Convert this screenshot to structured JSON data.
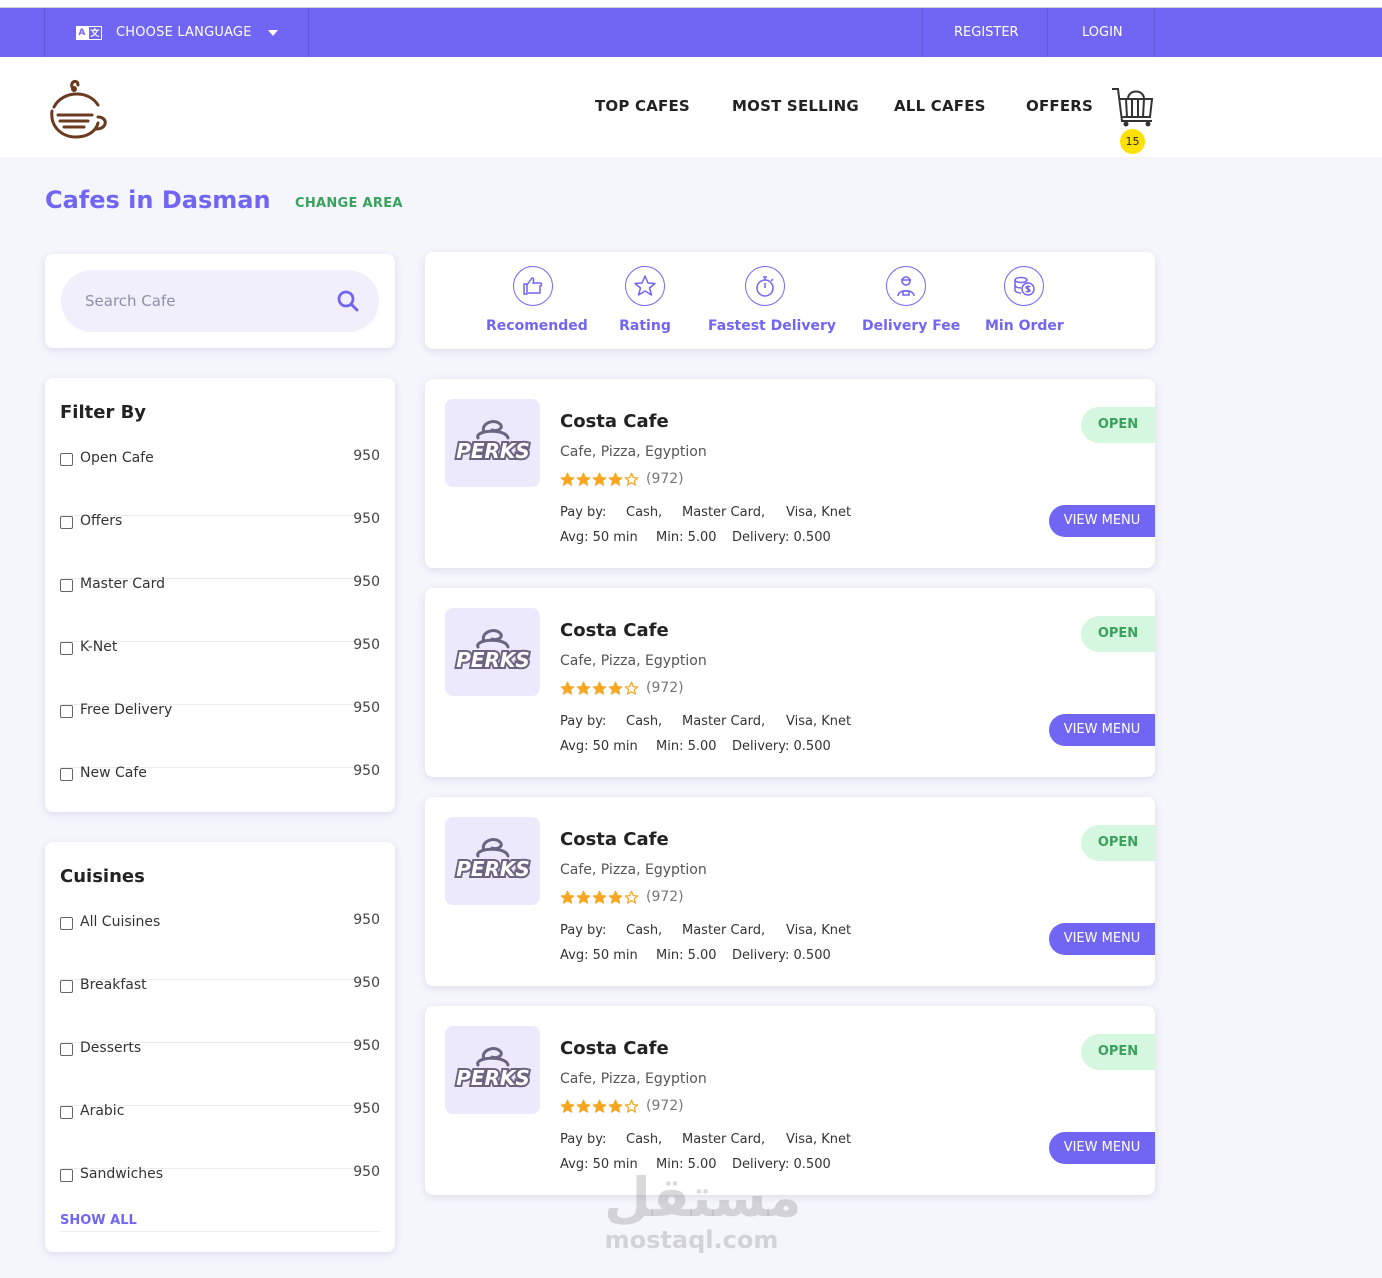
{
  "topbar": {
    "language_label": "CHOOSE LANGUAGE",
    "language_icon": "translate-icon",
    "register_label": "REGISTER",
    "login_label": "LOGIN"
  },
  "nav": {
    "items": [
      "TOP CAFES",
      "MOST SELLING",
      "ALL CAFES",
      "OFFERS"
    ],
    "cart_count": "15"
  },
  "page": {
    "title": "Cafes in Dasman",
    "change_area": "CHANGE AREA"
  },
  "search": {
    "placeholder": "Search Cafe"
  },
  "sort": {
    "items": [
      "Recomended",
      "Rating",
      "Fastest Delivery",
      "Delivery Fee",
      "Min Order"
    ]
  },
  "filter": {
    "title": "Filter By",
    "items": [
      {
        "label": "Open Cafe",
        "count": "950"
      },
      {
        "label": "Offers",
        "count": "950"
      },
      {
        "label": "Master Card",
        "count": "950"
      },
      {
        "label": "K-Net",
        "count": "950"
      },
      {
        "label": "Free Delivery",
        "count": "950"
      },
      {
        "label": "New Cafe",
        "count": "950"
      }
    ]
  },
  "cuisines": {
    "title": "Cuisines",
    "items": [
      {
        "label": "All Cuisines",
        "count": "950"
      },
      {
        "label": "Breakfast",
        "count": "950"
      },
      {
        "label": "Desserts",
        "count": "950"
      },
      {
        "label": "Arabic",
        "count": "950"
      },
      {
        "label": "Sandwiches",
        "count": "950"
      }
    ],
    "show_all": "SHOW ALL"
  },
  "cafes": [
    {
      "name": "Costa Cafe",
      "cuisine": "Cafe, Pizza, Egyption",
      "rating": 4,
      "reviews": "(972)",
      "pay_label": "Pay by:",
      "pay_1": "Cash,",
      "pay_2": "Master Card,",
      "pay_3": "Visa, Knet",
      "avg": "Avg: 50 min",
      "min": "Min: 5.00",
      "delivery": "Delivery: 0.500",
      "status": "OPEN",
      "button": "VIEW MENU",
      "logo_text": "PERKS"
    },
    {
      "name": "Costa Cafe",
      "cuisine": "Cafe, Pizza, Egyption",
      "rating": 4,
      "reviews": "(972)",
      "pay_label": "Pay by:",
      "pay_1": "Cash,",
      "pay_2": "Master Card,",
      "pay_3": "Visa, Knet",
      "avg": "Avg: 50 min",
      "min": "Min: 5.00",
      "delivery": "Delivery: 0.500",
      "status": "OPEN",
      "button": "VIEW MENU",
      "logo_text": "PERKS"
    },
    {
      "name": "Costa Cafe",
      "cuisine": "Cafe, Pizza, Egyption",
      "rating": 4,
      "reviews": "(972)",
      "pay_label": "Pay by:",
      "pay_1": "Cash,",
      "pay_2": "Master Card,",
      "pay_3": "Visa, Knet",
      "avg": "Avg: 50 min",
      "min": "Min: 5.00",
      "delivery": "Delivery: 0.500",
      "status": "OPEN",
      "button": "VIEW MENU",
      "logo_text": "PERKS"
    },
    {
      "name": "Costa Cafe",
      "cuisine": "Cafe, Pizza, Egyption",
      "rating": 4,
      "reviews": "(972)",
      "pay_label": "Pay by:",
      "pay_1": "Cash,",
      "pay_2": "Master Card,",
      "pay_3": "Visa, Knet",
      "avg": "Avg: 50 min",
      "min": "Min: 5.00",
      "delivery": "Delivery: 0.500",
      "status": "OPEN",
      "button": "VIEW MENU",
      "logo_text": "PERKS"
    }
  ],
  "watermark": {
    "arabic": "مستقل",
    "latin": "mostaql.com"
  },
  "colors": {
    "accent": "#7166f4",
    "open_green": "#3aa15c",
    "open_bg": "#d6f7df",
    "star": "#f5a623",
    "cart_badge": "#ffe000"
  }
}
